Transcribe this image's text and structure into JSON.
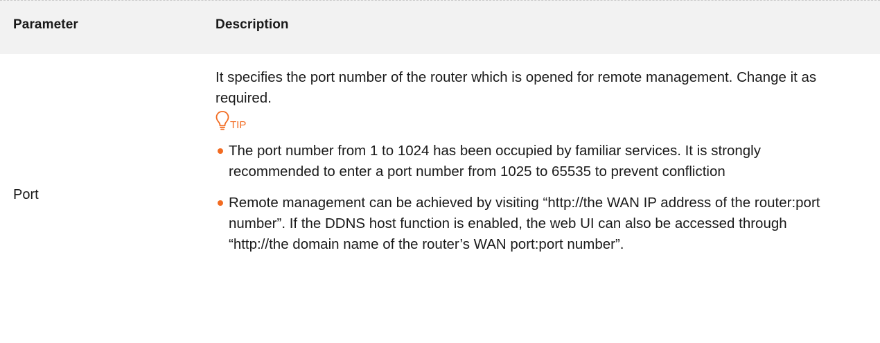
{
  "table": {
    "headers": {
      "parameter": "Parameter",
      "description": "Description"
    },
    "rows": [
      {
        "parameter": "Port",
        "intro": "It specifies the port number of the router which is opened for remote management. Change it as required.",
        "tip": {
          "icon": "lightbulb-icon",
          "label": "TIP",
          "color": "#f26b21"
        },
        "bullets": [
          "The port number from 1 to 1024 has been occupied by familiar services. It is strongly recommended to enter a port number from 1025 to 65535 to prevent confliction",
          "Remote management can be achieved by visiting “http://the WAN IP address of the router:port number”. If the DDNS host function is enabled, the web UI can also be accessed through “http://the domain name of the router’s WAN port:port number”."
        ]
      }
    ]
  },
  "colors": {
    "header_bg": "#f2f2f2",
    "accent": "#f26b21",
    "text": "#1a1a1a"
  }
}
